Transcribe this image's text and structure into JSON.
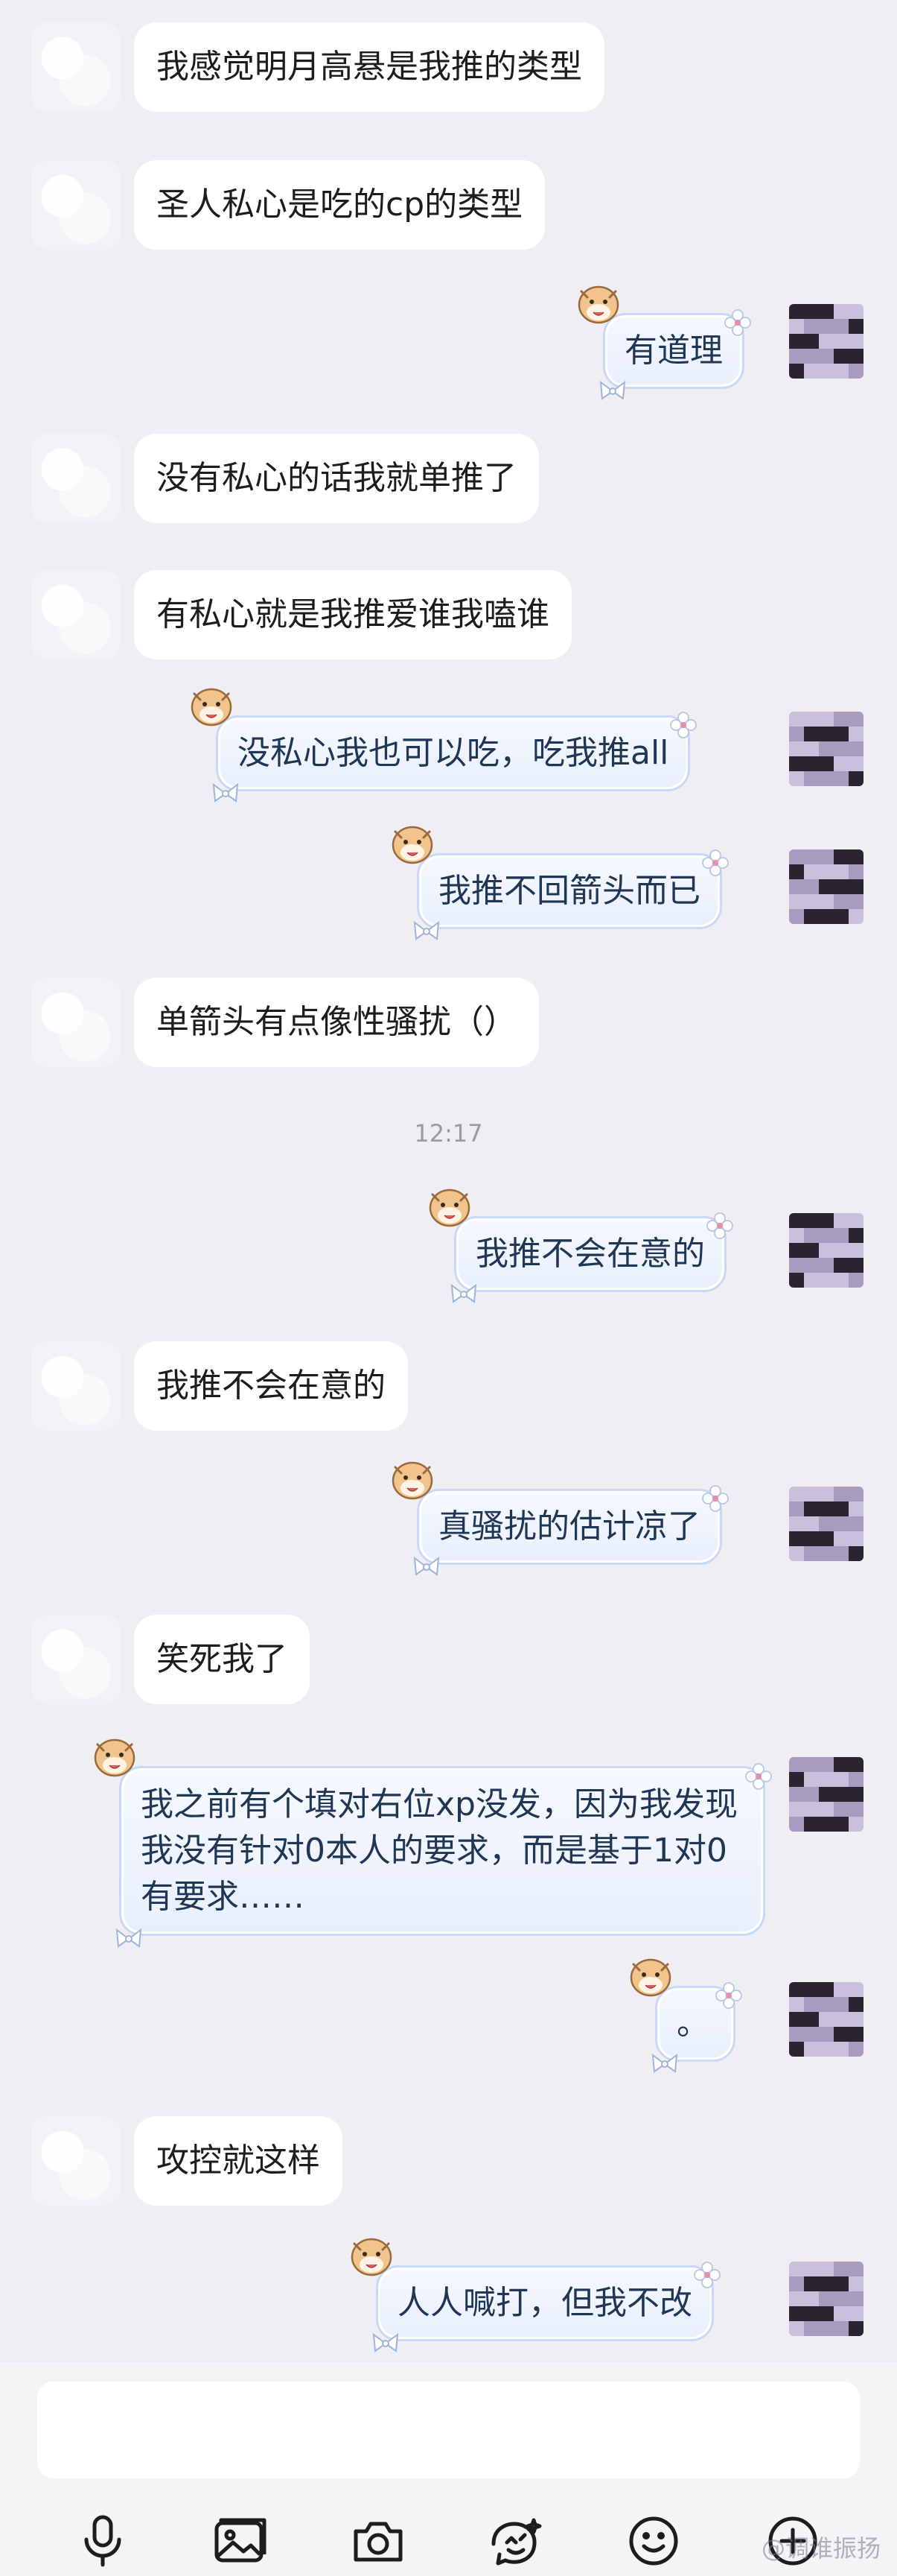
{
  "messages": [
    {
      "side": "left",
      "text": "我感觉明月高悬是我推的类型"
    },
    {
      "side": "left",
      "text": "圣人私心是吃的cp的类型"
    },
    {
      "side": "right",
      "text": "有道理"
    },
    {
      "side": "left",
      "text": "没有私心的话我就单推了"
    },
    {
      "side": "left",
      "text": "有私心就是我推爱谁我嗑谁"
    },
    {
      "side": "right",
      "text": "没私心我也可以吃，吃我推all"
    },
    {
      "side": "right",
      "text": "我推不回箭头而已"
    },
    {
      "side": "left",
      "text": "单箭头有点像性骚扰（）"
    },
    {
      "side": "right",
      "text": "我推不会在意的"
    },
    {
      "side": "left",
      "text": "我推不会在意的"
    },
    {
      "side": "right",
      "text": "真骚扰的估计凉了"
    },
    {
      "side": "left",
      "text": "笑死我了"
    },
    {
      "side": "right",
      "text": "我之前有个填对右位xp没发，因为我发现我没有针对0本人的要求，而是基于1对0有要求……"
    },
    {
      "side": "right",
      "text": "。"
    },
    {
      "side": "left",
      "text": "攻控就这样"
    },
    {
      "side": "right",
      "text": "人人喊打，但我不改"
    }
  ],
  "timestamp": "12:17",
  "input": {
    "value": ""
  },
  "toolbar": {
    "icons": [
      "microphone-icon",
      "image-icon",
      "camera-icon",
      "sticker-icon",
      "emoji-icon",
      "plus-icon"
    ]
  },
  "watermark": "@调谁振扬",
  "colors": {
    "background": "#eeeef3",
    "left_bubble": "#ffffff",
    "right_bubble_border": "#c9d8f5",
    "right_bubble_text": "#1f3654"
  }
}
